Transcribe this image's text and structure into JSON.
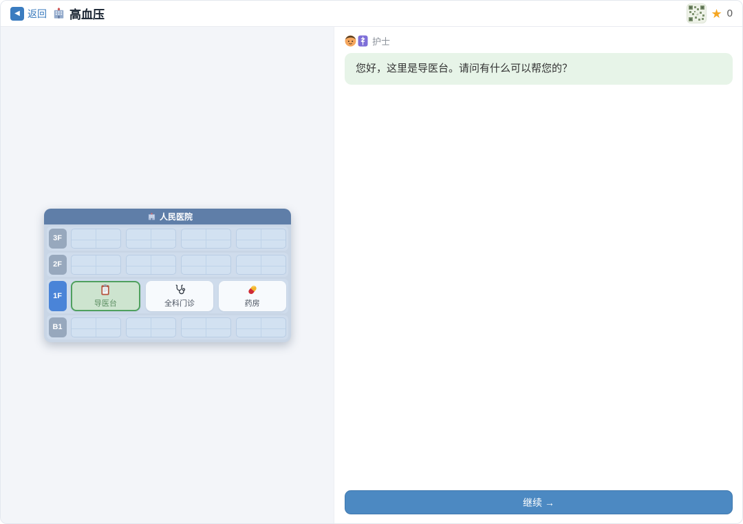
{
  "header": {
    "back_glyph": "◀",
    "back_label": "返回",
    "title_icon": "hospital-icon",
    "title": "高血压",
    "thumbnail_icon": "map-qr-thumbnail",
    "star_glyph": "★",
    "star_count": "0"
  },
  "map": {
    "title_icon": "hospital-icon",
    "title": "人民医院",
    "floors": [
      {
        "label": "3F",
        "active": false,
        "slot_count": 4,
        "rooms": []
      },
      {
        "label": "2F",
        "active": false,
        "slot_count": 4,
        "rooms": []
      },
      {
        "label": "1F",
        "active": true,
        "slot_count": 0,
        "rooms": [
          {
            "icon": "clipboard-icon",
            "name": "导医台",
            "selected": true
          },
          {
            "icon": "stethoscope-icon",
            "name": "全科门诊",
            "selected": false
          },
          {
            "icon": "pill-icon",
            "name": "药房",
            "selected": false
          }
        ]
      },
      {
        "label": "B1",
        "active": false,
        "slot_count": 4,
        "rooms": []
      }
    ]
  },
  "chat": {
    "speaker_icon": "nurse-avatar",
    "speaker": "护士",
    "message": "您好，这里是导医台。请问有什么可以帮您的？"
  },
  "footer": {
    "continue_label": "继续 →"
  },
  "colors": {
    "accent_blue": "#4c89c2",
    "active_floor_blue": "#4a84d8",
    "selected_room_green": "#4fa05e",
    "bubble_green": "#e7f4e8",
    "map_header_blue": "#5f7ea8",
    "link_blue": "#3779bd",
    "star_gold": "#f5a623"
  }
}
